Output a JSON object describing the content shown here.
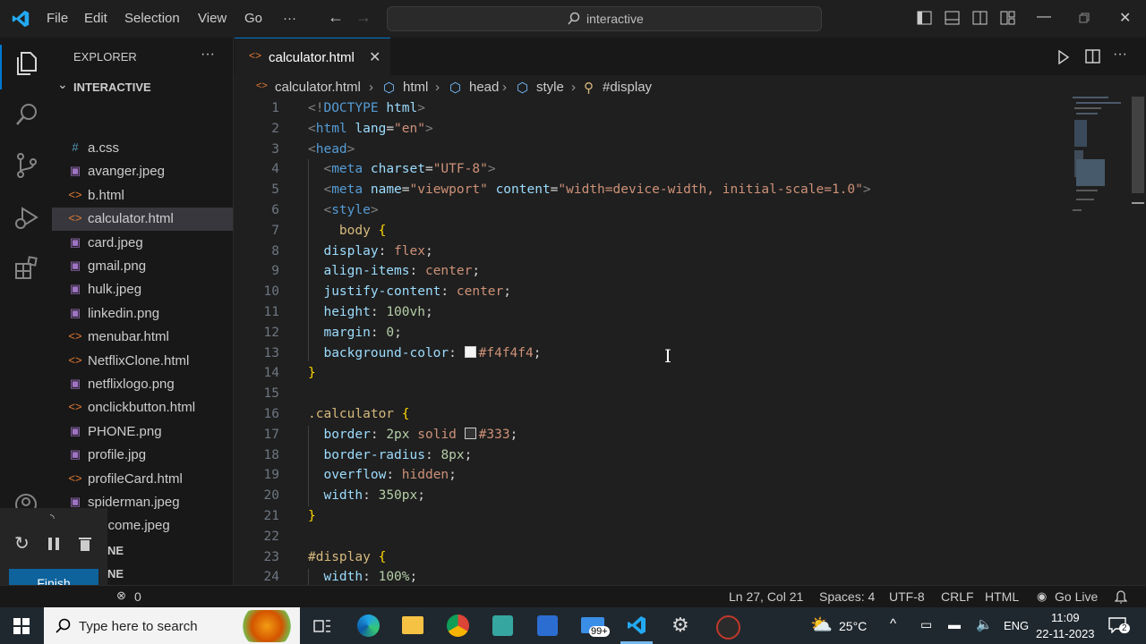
{
  "titlebar": {
    "menu": [
      "File",
      "Edit",
      "Selection",
      "View",
      "Go",
      "···"
    ],
    "search_text": "interactive",
    "colors": {
      "accent": "#0078d4"
    }
  },
  "sidebar": {
    "title": "EXPLORER",
    "more": "···",
    "folder": "INTERACTIVE",
    "files": [
      {
        "name": "a.css",
        "icon": "#",
        "color": "#519aba"
      },
      {
        "name": "avanger.jpeg",
        "icon": "▣",
        "color": "#a074c4"
      },
      {
        "name": "b.html",
        "icon": "<>",
        "color": "#e37933"
      },
      {
        "name": "calculator.html",
        "icon": "<>",
        "color": "#e37933"
      },
      {
        "name": "card.jpeg",
        "icon": "▣",
        "color": "#a074c4"
      },
      {
        "name": "gmail.png",
        "icon": "▣",
        "color": "#a074c4"
      },
      {
        "name": "hulk.jpeg",
        "icon": "▣",
        "color": "#a074c4"
      },
      {
        "name": "linkedin.png",
        "icon": "▣",
        "color": "#a074c4"
      },
      {
        "name": "menubar.html",
        "icon": "<>",
        "color": "#e37933"
      },
      {
        "name": "NetflixClone.html",
        "icon": "<>",
        "color": "#e37933"
      },
      {
        "name": "netflixlogo.png",
        "icon": "▣",
        "color": "#a074c4"
      },
      {
        "name": "onclickbutton.html",
        "icon": "<>",
        "color": "#e37933"
      },
      {
        "name": "PHONE.png",
        "icon": "▣",
        "color": "#a074c4"
      },
      {
        "name": "profile.jpg",
        "icon": "▣",
        "color": "#a074c4"
      },
      {
        "name": "profileCard.html",
        "icon": "<>",
        "color": "#e37933"
      },
      {
        "name": "spiderman.jpeg",
        "icon": "▣",
        "color": "#a074c4"
      },
      {
        "name": "welcome.jpeg",
        "icon": "▣",
        "color": "#a074c4"
      }
    ],
    "outline_partial": "NE",
    "timeline_partial": "NE",
    "finish_label": "Finish"
  },
  "tab": {
    "label": "calculator.html",
    "close": "✕"
  },
  "breadcrumb": [
    "calculator.html",
    "html",
    "head",
    "style",
    "#display"
  ],
  "code_lines": [
    {
      "n": "1",
      "html": "<span class='tg'>&lt;!</span><span class='tn'>DOCTYPE</span> <span class='at'>html</span><span class='tg'>&gt;</span>"
    },
    {
      "n": "2",
      "html": "<span class='tg'>&lt;</span><span class='tn'>html</span> <span class='at'>lang</span>=<span class='st'>\"en\"</span><span class='tg'>&gt;</span>"
    },
    {
      "n": "3",
      "html": "<span class='tg'>&lt;</span><span class='tn'>head</span><span class='tg'>&gt;</span>"
    },
    {
      "n": "4",
      "html": "  <span class='tg'>&lt;</span><span class='tn'>meta</span> <span class='at'>charset</span>=<span class='st'>\"UTF-8\"</span><span class='tg'>&gt;</span>"
    },
    {
      "n": "5",
      "html": "  <span class='tg'>&lt;</span><span class='tn'>meta</span> <span class='at'>name</span>=<span class='st'>\"viewport\"</span> <span class='at'>content</span>=<span class='st'>\"width=device-width, initial-scale=1.0\"</span><span class='tg'>&gt;</span>"
    },
    {
      "n": "6",
      "html": "  <span class='tg'>&lt;</span><span class='tn'>style</span><span class='tg'>&gt;</span>"
    },
    {
      "n": "7",
      "html": "    <span class='sel-c'>body</span> <span class='br'>{</span>"
    },
    {
      "n": "8",
      "html": "  <span class='pr'>display</span>: <span class='vl'>flex</span>;"
    },
    {
      "n": "9",
      "html": "  <span class='pr'>align-items</span>: <span class='vl'>center</span>;"
    },
    {
      "n": "10",
      "html": "  <span class='pr'>justify-content</span>: <span class='vl'>center</span>;"
    },
    {
      "n": "11",
      "html": "  <span class='pr'>height</span>: <span class='num'>100vh</span>;"
    },
    {
      "n": "12",
      "html": "  <span class='pr'>margin</span>: <span class='num'>0</span>;"
    },
    {
      "n": "13",
      "html": "  <span class='pr'>background-color</span>: <span class='sw' style='background:#f4f4f4'></span><span class='vl'>#f4f4f4</span>;"
    },
    {
      "n": "14",
      "html": "<span class='br'>}</span>"
    },
    {
      "n": "15",
      "html": ""
    },
    {
      "n": "16",
      "html": "<span class='sel-c'>.calculator</span> <span class='br'>{</span>"
    },
    {
      "n": "17",
      "html": "  <span class='pr'>border</span>: <span class='num'>2px</span> <span class='vl'>solid</span> <span class='sw' style='background:#333333'></span><span class='vl'>#333</span>;"
    },
    {
      "n": "18",
      "html": "  <span class='pr'>border-radius</span>: <span class='num'>8px</span>;"
    },
    {
      "n": "19",
      "html": "  <span class='pr'>overflow</span>: <span class='vl'>hidden</span>;"
    },
    {
      "n": "20",
      "html": "  <span class='pr'>width</span>: <span class='num'>350px</span>;"
    },
    {
      "n": "21",
      "html": "<span class='br'>}</span>"
    },
    {
      "n": "22",
      "html": ""
    },
    {
      "n": "23",
      "html": "<span class='sel-c'>#display</span> <span class='br'>{</span>"
    },
    {
      "n": "24",
      "html": "  <span class='pr'>width</span>: <span class='num'>100%</span>;"
    }
  ],
  "status": {
    "problems": "0",
    "cursor": "Ln 27, Col 21",
    "spaces": "Spaces: 4",
    "encoding": "UTF-8",
    "eol": "CRLF",
    "language": "HTML",
    "golive": "Go Live"
  },
  "taskbar": {
    "search_placeholder": "Type here to search",
    "weather": "25°C",
    "lang": "ENG",
    "time": "11:09",
    "date": "22-11-2023",
    "mail_badge": "99+",
    "notif_count": "2"
  }
}
